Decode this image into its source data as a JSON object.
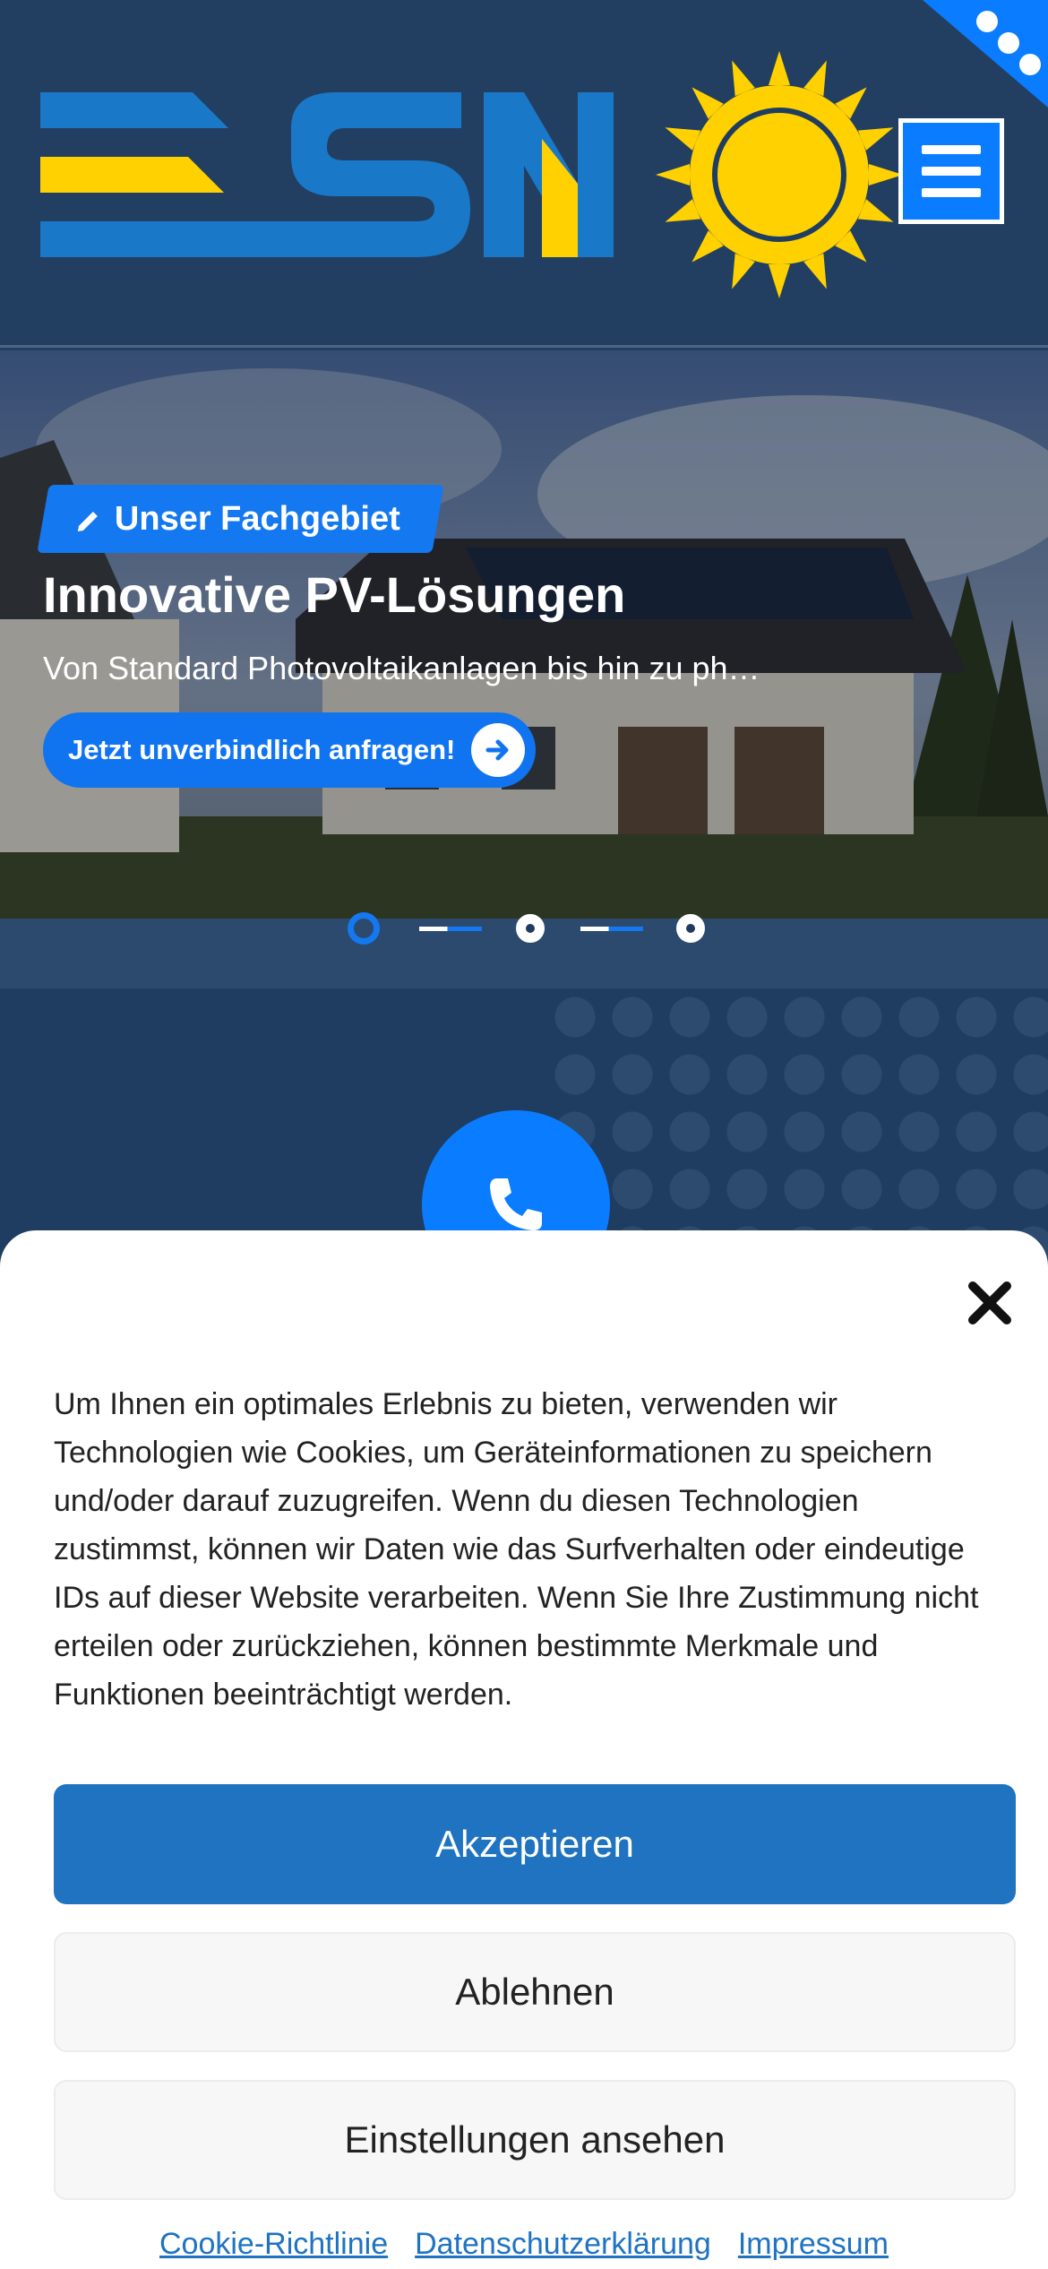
{
  "colors": {
    "header_bg": "#223f61",
    "brand_blue": "#0a7cff",
    "logo_blue": "#1a78c8",
    "logo_yellow": "#ffd100",
    "accept_blue": "#1f73c1"
  },
  "header": {
    "logo_text": "ESN",
    "menu_icon": "hamburger-icon",
    "corner_icon": "more-dots-icon"
  },
  "hero": {
    "badge_label": "Unser Fachgebiet",
    "badge_icon": "pencil-icon",
    "title": "Innovative PV-Lösungen",
    "subtitle": "Von Standard Photovoltaikanlagen bis hin zu ph…",
    "cta_label": "Jetzt unverbindlich anfragen!",
    "cta_icon": "arrow-right-icon",
    "slides": {
      "count": 3,
      "active": 1
    }
  },
  "contact": {
    "icon": "phone-icon"
  },
  "cookie": {
    "text": "Um Ihnen ein optimales Erlebnis zu bieten, verwenden wir Technologien wie Cookies, um Geräteinformationen zu speichern und/oder darauf zuzugreifen. Wenn du diesen Technologien zustimmst, können wir Daten wie das Surfverhalten oder eindeutige IDs auf dieser Website verarbeiten. Wenn Sie Ihre Zustimmung nicht erteilen oder zurückziehen, können bestimmte Merkmale und Funktionen beeinträchtigt werden.",
    "accept_label": "Akzeptieren",
    "deny_label": "Ablehnen",
    "settings_label": "Einstellungen ansehen",
    "links": [
      "Cookie-Richtlinie",
      "Datenschutzerklärung",
      "Impressum"
    ]
  }
}
